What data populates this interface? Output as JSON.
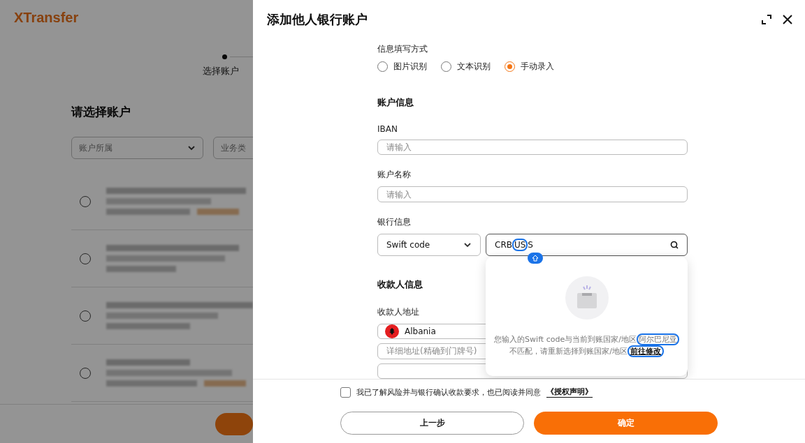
{
  "background_page": {
    "logo": "XTransfer",
    "step": {
      "label": "选择账户"
    },
    "heading": "请选择账户",
    "filters": [
      {
        "placeholder": "账户所属"
      },
      {
        "placeholder": "业务类"
      }
    ],
    "accounts": [
      {
        "selected": false,
        "tag": true
      },
      {
        "selected": false,
        "tag": false
      },
      {
        "selected": false,
        "tag": false
      },
      {
        "selected": false,
        "tag": true
      }
    ]
  },
  "drawer": {
    "title": "添加他人银行账户",
    "input_method": {
      "label": "信息填写方式",
      "options": [
        {
          "label": "图片识别",
          "selected": false
        },
        {
          "label": "文本识别",
          "selected": false
        },
        {
          "label": "手动录入",
          "selected": true
        }
      ]
    },
    "account_info": {
      "heading": "账户信息",
      "fields": [
        {
          "label": "IBAN",
          "placeholder": "请输入"
        },
        {
          "label": "账户名称",
          "placeholder": "请输入"
        }
      ]
    },
    "bank_info": {
      "label": "银行信息",
      "code_type": "Swift code",
      "code_value": {
        "before": "CRB",
        "marked": "US",
        "after": "S"
      }
    },
    "popover": {
      "message_1": "您输入的Swift code与当前到账国家/地区",
      "country": "阿尔巴尼亚",
      "message_2": "不匹配，请重新选择到账国家/地区",
      "link": "前往修改"
    },
    "payee": {
      "heading": "收款人信息",
      "address_label": "收款人地址",
      "country": "Albania",
      "detail_placeholder": "详细地址(精确到门牌号)"
    },
    "footer": {
      "agreement": {
        "checked": false,
        "text": "我已了解风险并与银行确认收款要求，也已阅读并同意",
        "link": "《授权声明》"
      },
      "buttons": [
        {
          "label": "上一步",
          "kind": "secondary"
        },
        {
          "label": "确定",
          "kind": "primary"
        }
      ]
    }
  }
}
